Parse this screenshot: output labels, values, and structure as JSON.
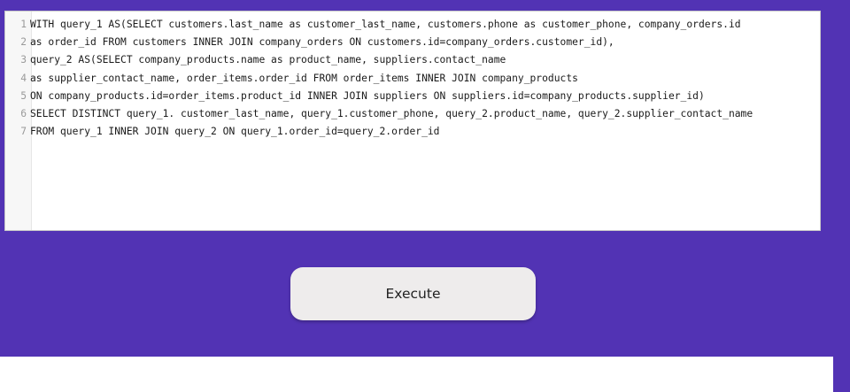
{
  "editor": {
    "lines": [
      {
        "num": "1",
        "text": "WITH query_1 AS(SELECT customers.last_name as customer_last_name, customers.phone as customer_phone, company_orders.id"
      },
      {
        "num": "2",
        "text": "as order_id FROM customers INNER JOIN company_orders ON customers.id=company_orders.customer_id),"
      },
      {
        "num": "3",
        "text": "query_2 AS(SELECT company_products.name as product_name, suppliers.contact_name"
      },
      {
        "num": "4",
        "text": "as supplier_contact_name, order_items.order_id FROM order_items INNER JOIN company_products"
      },
      {
        "num": "5",
        "text": "ON company_products.id=order_items.product_id INNER JOIN suppliers ON suppliers.id=company_products.supplier_id)"
      },
      {
        "num": "6",
        "text": "SELECT DISTINCT query_1. customer_last_name, query_1.customer_phone, query_2.product_name, query_2.supplier_contact_name"
      },
      {
        "num": "7",
        "text": "FROM query_1 INNER JOIN query_2 ON query_1.order_id=query_2.order_id"
      }
    ]
  },
  "execute_label": "Execute",
  "colors": {
    "background": "#5233b4",
    "editor_bg": "#ffffff",
    "button_bg": "#eeecec"
  }
}
